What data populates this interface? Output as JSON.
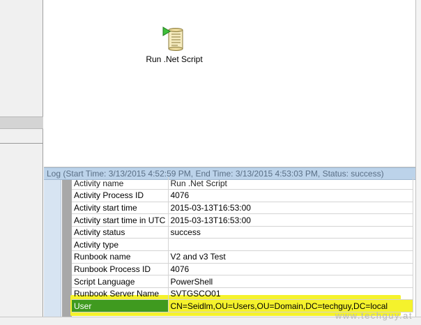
{
  "canvas": {
    "activity": {
      "label": "Run .Net Script",
      "icon": "script-scroll-icon"
    }
  },
  "log": {
    "header": "Log  (Start Time: 3/13/2015 4:52:59 PM, End Time: 3/13/2015 4:53:03 PM, Status: success)",
    "rows": [
      {
        "key": "Activity name",
        "value": "Run .Net Script"
      },
      {
        "key": "Activity Process ID",
        "value": "4076"
      },
      {
        "key": "Activity start time",
        "value": "2015-03-13T16:53:00"
      },
      {
        "key": "Activity start time in UTC",
        "value": "2015-03-13T16:53:00"
      },
      {
        "key": "Activity status",
        "value": "success"
      },
      {
        "key": "Activity type",
        "value": ""
      },
      {
        "key": "Runbook name",
        "value": "V2 and v3 Test"
      },
      {
        "key": "Runbook Process ID",
        "value": "4076"
      },
      {
        "key": "Script Language",
        "value": "PowerShell"
      },
      {
        "key": "Runbook Server Name",
        "value": "SVTGSCO01"
      },
      {
        "key": "User",
        "value": "CN=Seidlm,OU=Users,OU=Domain,DC=techguy,DC=local"
      }
    ]
  },
  "watermark": "www.techguy.at",
  "colors": {
    "highlight": "#f5f22c",
    "selected_key": "#3f9a1f",
    "log_header": "#bcd3ea"
  }
}
